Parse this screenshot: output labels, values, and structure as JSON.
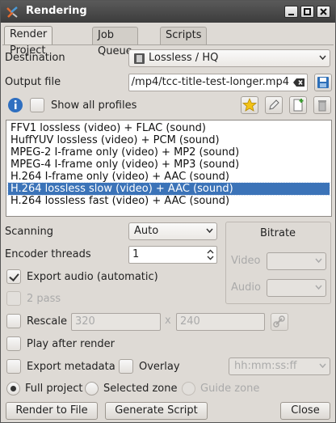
{
  "window": {
    "title": "Rendering"
  },
  "tabs": [
    "Render Project",
    "Job Queue",
    "Scripts"
  ],
  "destination": {
    "label": "Destination",
    "value": "Lossless / HQ"
  },
  "output": {
    "label": "Output file",
    "value": "/mp4/tcc-title-test-longer.mp4"
  },
  "profiles": {
    "show_all_label": "Show all profiles",
    "items": [
      "FFV1 lossless (video) + FLAC (sound)",
      "HuffYUV lossless (video) + PCM (sound)",
      "MPEG-2 I-frame only (video) + MP2 (sound)",
      "MPEG-4 I-frame only (video) + MP3 (sound)",
      "H.264 I-frame only (video) + AAC (sound)",
      "H.264 lossless slow (video) + AAC (sound)",
      "H.264 lossless fast (video) + AAC (sound)"
    ],
    "selected_index": 5
  },
  "scanning": {
    "label": "Scanning",
    "value": "Auto"
  },
  "threads": {
    "label": "Encoder threads",
    "value": "1"
  },
  "bitrate": {
    "title": "Bitrate",
    "video_label": "Video",
    "audio_label": "Audio"
  },
  "export_audio": {
    "label": "Export audio (automatic)",
    "checked": true
  },
  "two_pass": {
    "label": "2 pass"
  },
  "rescale": {
    "label": "Rescale",
    "width": "320",
    "x": "x",
    "height": "240"
  },
  "play_after": {
    "label": "Play after render"
  },
  "export_metadata": {
    "label": "Export metadata"
  },
  "overlay": {
    "label": "Overlay",
    "value": "hh:mm:ss:ff"
  },
  "zone": {
    "full": "Full project",
    "selected": "Selected zone",
    "guide": "Guide zone"
  },
  "buttons": {
    "render": "Render to File",
    "generate": "Generate Script",
    "close": "Close"
  },
  "colors": {
    "selection": "#3b73b8",
    "titlebar": "#444444"
  }
}
